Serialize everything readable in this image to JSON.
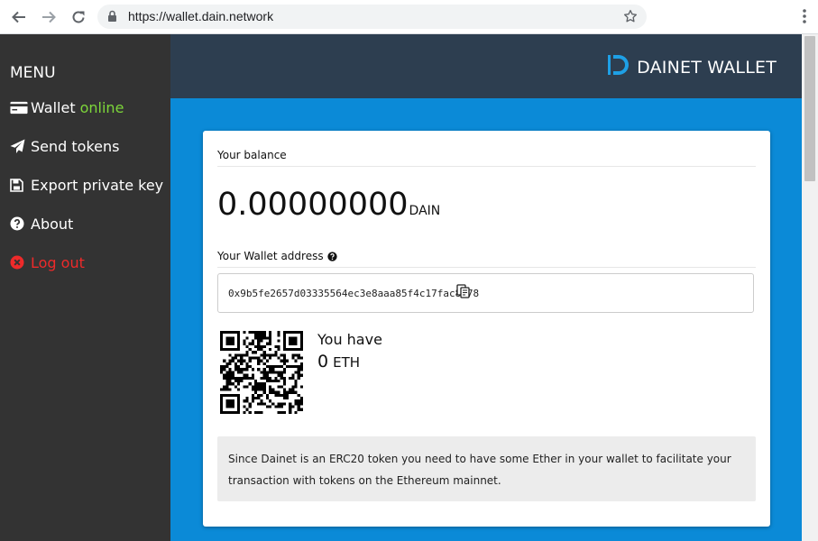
{
  "browser": {
    "url": "https://wallet.dain.network",
    "icons": [
      "back-arrow-icon",
      "forward-arrow-icon",
      "reload-icon",
      "lock-icon",
      "bookmark-star-icon",
      "more-vert-icon"
    ]
  },
  "sidebar": {
    "title": "MENU",
    "items": [
      {
        "label": "Wallet",
        "status": "online",
        "icon": "wallet-card-icon"
      },
      {
        "label": "Send tokens",
        "icon": "paper-plane-icon"
      },
      {
        "label": "Export private key",
        "icon": "floppy-save-icon"
      },
      {
        "label": "About",
        "icon": "question-circle-icon"
      },
      {
        "label": "Log out",
        "icon": "times-circle-icon"
      }
    ]
  },
  "header": {
    "brand": "DAINET WALLET",
    "logo": "dainet-logo-icon"
  },
  "card": {
    "balance_label": "Your balance",
    "balance_amount": "0.00000000",
    "balance_unit": "DAIN",
    "address_label": "Your Wallet address",
    "address": "0x9b5fe2657d03335564ec3e8aaa85f4c17fac8878",
    "you_have": "You have",
    "eth_amount": "0",
    "eth_unit": "ETH",
    "note": "Since Dainet is an ERC20 token you need to have some Ether in your wallet to facilitate your transaction with tokens on the Ethereum mainnet."
  },
  "colors": {
    "sidebar_bg": "#333333",
    "header_bg": "#2d3e50",
    "main_bg": "#0b8ad7",
    "online": "#7dd63a",
    "logout": "#ee2a2a",
    "logo_accent": "#1ea0e6"
  }
}
